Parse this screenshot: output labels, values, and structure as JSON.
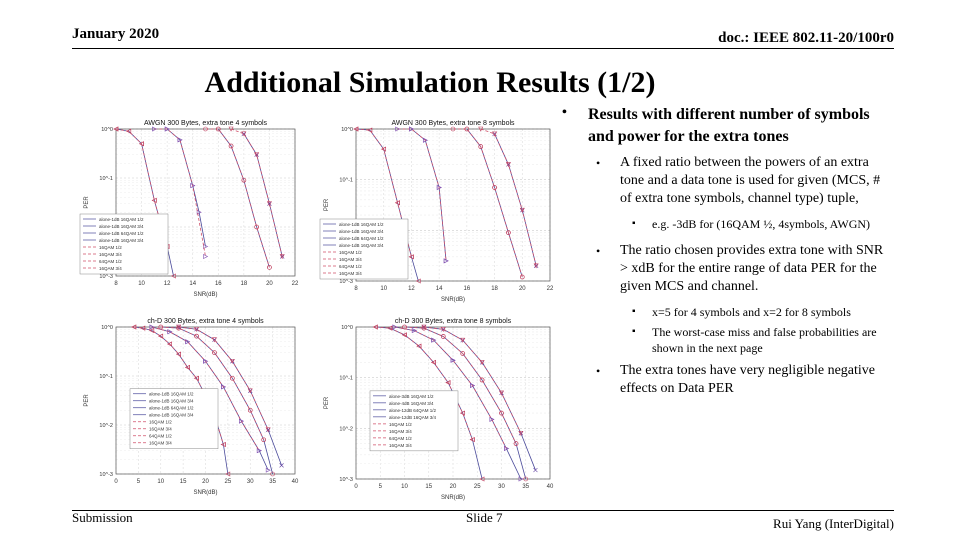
{
  "header": {
    "date": "January 2020",
    "doc": "doc.: IEEE 802.11-20/100r0"
  },
  "title": "Additional Simulation Results (1/2)",
  "bullets": {
    "main": "Results with different number of symbols and power for the extra tones",
    "sub1": "A fixed ratio between the powers of an extra tone and a data tone is used for given (MCS, # of extra tone symbols, channel type) tuple,",
    "sub1_1": "e.g. -3dB for (16QAM ½, 4symbols, AWGN)",
    "sub2": "The ratio chosen provides extra tone with SNR > xdB for the entire range of data PER for the given MCS and channel.",
    "sub2_1": "x=5 for 4 symbols and x=2 for 8 symbols",
    "sub2_2": "The worst-case miss and false probabilities are shown in the next page",
    "sub3": "The extra tones have very negligible negative effects on Data PER"
  },
  "footer": {
    "left": "Submission",
    "center": "Slide 7",
    "right": "Rui Yang (InterDigital)"
  },
  "chart_data": [
    {
      "type": "line",
      "title": "AWGN 300 Bytes, extra tone 4 symbols",
      "xlabel": "SNR(dB)",
      "ylabel": "PER",
      "xlim": [
        8,
        22
      ],
      "ylim": [
        0.001,
        1
      ],
      "yscale": "log",
      "xticks": [
        8,
        10,
        12,
        14,
        16,
        18,
        20,
        22
      ],
      "yticks": [
        "10^0",
        "10^-1",
        "10^-2",
        "10^-3"
      ],
      "grid": true,
      "legend": "bottom-left",
      "series": [
        {
          "name": "alone-1dB 16QAM 1/2",
          "x": [
            8,
            9,
            10,
            11,
            12,
            12.5
          ],
          "y": [
            1,
            0.9,
            0.5,
            0.035,
            0.004,
            0.001
          ]
        },
        {
          "name": "alone-1dB 16QAM 3/4",
          "x": [
            12,
            13,
            14,
            14.5,
            15
          ],
          "y": [
            1,
            0.6,
            0.07,
            0.02,
            0.004
          ]
        },
        {
          "name": "alone-1dB 64QAM 1/2",
          "x": [
            16,
            17,
            18,
            19,
            20
          ],
          "y": [
            1,
            0.45,
            0.09,
            0.01,
            0.0015
          ]
        },
        {
          "name": "alone-1dB 16QAM 3/4",
          "x": [
            18,
            19,
            20,
            21
          ],
          "y": [
            0.8,
            0.3,
            0.03,
            0.0025
          ]
        },
        {
          "name": "16QAM 1/2",
          "x": [
            8,
            9,
            10,
            11,
            12
          ],
          "y": [
            1,
            0.9,
            0.5,
            0.035,
            0.004
          ]
        },
        {
          "name": "16QAM 3/4",
          "x": [
            11,
            12,
            13,
            14,
            15
          ],
          "y": [
            1,
            1,
            0.6,
            0.07,
            0.0025
          ]
        },
        {
          "name": "64QAM 1/2",
          "x": [
            15,
            16,
            17,
            18,
            19,
            20
          ],
          "y": [
            1,
            1,
            0.45,
            0.09,
            0.01,
            0.0015
          ]
        },
        {
          "name": "16QAM 3/4",
          "x": [
            17,
            18,
            19,
            20,
            21
          ],
          "y": [
            1,
            0.8,
            0.3,
            0.03,
            0.0025
          ]
        }
      ]
    },
    {
      "type": "line",
      "title": "AWGN 300 Bytes, extra tone 8 symbols",
      "xlabel": "SNR(dB)",
      "ylabel": "PER",
      "xlim": [
        8,
        22
      ],
      "ylim": [
        0.001,
        1
      ],
      "yscale": "log",
      "xticks": [
        8,
        10,
        12,
        14,
        16,
        18,
        20,
        22
      ],
      "yticks": [
        "10^0",
        "10^-1",
        "10^-2",
        "10^-3"
      ],
      "grid": true,
      "legend": "bottom-left",
      "series": [
        {
          "name": "alone-1dB 16QAM 1/2",
          "x": [
            8,
            9,
            10,
            11,
            12,
            12.5
          ],
          "y": [
            1,
            0.95,
            0.4,
            0.035,
            0.003,
            0.001
          ]
        },
        {
          "name": "alone-1dB 16QAM 3/4",
          "x": [
            12,
            13,
            14,
            14.5
          ],
          "y": [
            1,
            0.6,
            0.07,
            0.0025
          ]
        },
        {
          "name": "alone-1dB 64QAM 1/2",
          "x": [
            16,
            17,
            18,
            19,
            20
          ],
          "y": [
            1,
            0.45,
            0.07,
            0.009,
            0.0012
          ]
        },
        {
          "name": "alone-1dB 16QAM 3/4",
          "x": [
            18,
            19,
            20,
            21
          ],
          "y": [
            0.8,
            0.2,
            0.025,
            0.002
          ]
        },
        {
          "name": "16QAM 1/2",
          "x": [
            8,
            9,
            10,
            11,
            12
          ],
          "y": [
            1,
            0.95,
            0.4,
            0.035,
            0.003
          ]
        },
        {
          "name": "16QAM 3/4",
          "x": [
            11,
            12,
            13,
            14,
            14.5
          ],
          "y": [
            1,
            1,
            0.6,
            0.07,
            0.0025
          ]
        },
        {
          "name": "64QAM 1/2",
          "x": [
            15,
            16,
            17,
            18,
            19,
            20
          ],
          "y": [
            1,
            1,
            0.45,
            0.07,
            0.009,
            0.0012
          ]
        },
        {
          "name": "16QAM 3/4",
          "x": [
            17,
            18,
            19,
            20,
            21
          ],
          "y": [
            1,
            0.8,
            0.2,
            0.025,
            0.002
          ]
        }
      ]
    },
    {
      "type": "line",
      "title": "ch-D 300 Bytes, extra tone 4 symbols",
      "xlabel": "SNR(dB)",
      "ylabel": "PER",
      "xlim": [
        0,
        40
      ],
      "ylim": [
        0.001,
        1
      ],
      "yscale": "log",
      "xticks": [
        0,
        5,
        10,
        15,
        20,
        25,
        30,
        35,
        40
      ],
      "yticks": [
        "10^0",
        "10^-1",
        "10^-2",
        "10^-3"
      ],
      "grid": true,
      "legend": "center-left",
      "series": [
        {
          "name": "alone-1dB 16QAM 1/2",
          "x": [
            4,
            6,
            8,
            10,
            12,
            14,
            16,
            18,
            20,
            22,
            24,
            25
          ],
          "y": [
            1,
            0.95,
            0.85,
            0.65,
            0.45,
            0.28,
            0.15,
            0.09,
            0.04,
            0.016,
            0.004,
            0.001
          ]
        },
        {
          "name": "alone-1dB 16QAM 3/4",
          "x": [
            8,
            12,
            16,
            20,
            24,
            28,
            32,
            34
          ],
          "y": [
            1,
            0.8,
            0.5,
            0.2,
            0.06,
            0.012,
            0.003,
            0.0012
          ]
        },
        {
          "name": "alone-1dB 64QAM 1/2",
          "x": [
            10,
            14,
            18,
            22,
            26,
            30,
            33,
            35
          ],
          "y": [
            1,
            0.95,
            0.65,
            0.3,
            0.09,
            0.02,
            0.005,
            0.001
          ]
        },
        {
          "name": "alone-1dB 16QAM 3/4",
          "x": [
            14,
            18,
            22,
            26,
            30,
            34,
            37
          ],
          "y": [
            1,
            0.9,
            0.55,
            0.2,
            0.05,
            0.008,
            0.0015
          ]
        },
        {
          "name": "16QAM 1/2",
          "x": [
            4,
            6,
            8,
            10,
            12,
            14,
            16,
            18,
            20,
            22,
            24
          ],
          "y": [
            1,
            0.95,
            0.85,
            0.65,
            0.45,
            0.28,
            0.15,
            0.09,
            0.04,
            0.016,
            0.004
          ]
        },
        {
          "name": "16QAM 3/4",
          "x": [
            8,
            12,
            16,
            20,
            24,
            28,
            32
          ],
          "y": [
            1,
            0.8,
            0.5,
            0.2,
            0.06,
            0.012,
            0.003
          ]
        },
        {
          "name": "64QAM 1/2",
          "x": [
            10,
            14,
            18,
            22,
            26,
            30,
            33
          ],
          "y": [
            1,
            0.95,
            0.65,
            0.3,
            0.09,
            0.02,
            0.005
          ]
        },
        {
          "name": "16QAM 3/4",
          "x": [
            14,
            18,
            22,
            26,
            30,
            34
          ],
          "y": [
            1,
            0.9,
            0.55,
            0.2,
            0.05,
            0.008
          ]
        }
      ]
    },
    {
      "type": "line",
      "title": "ch-D 300 Bytes, extra tone 8 symbols",
      "xlabel": "SNR(dB)",
      "ylabel": "PER",
      "xlim": [
        0,
        40
      ],
      "ylim": [
        0.001,
        1
      ],
      "yscale": "log",
      "xticks": [
        0,
        5,
        10,
        15,
        20,
        25,
        30,
        35,
        40
      ],
      "yticks": [
        "10^0",
        "10^-1",
        "10^-2",
        "10^-3"
      ],
      "grid": true,
      "legend": "center-left",
      "series": [
        {
          "name": "alone-3dB 16QAM 1/2",
          "x": [
            4,
            7,
            10,
            13,
            16,
            19,
            22,
            24,
            26
          ],
          "y": [
            1,
            0.95,
            0.7,
            0.42,
            0.2,
            0.08,
            0.02,
            0.006,
            0.001
          ]
        },
        {
          "name": "alone-4dB 16QAM 3/4",
          "x": [
            8,
            12,
            16,
            20,
            24,
            28,
            31,
            34
          ],
          "y": [
            1,
            0.85,
            0.55,
            0.22,
            0.07,
            0.015,
            0.004,
            0.001
          ]
        },
        {
          "name": "alone-12dB 64QAM 1/2",
          "x": [
            10,
            14,
            18,
            22,
            26,
            30,
            33,
            35
          ],
          "y": [
            1,
            0.95,
            0.65,
            0.3,
            0.09,
            0.02,
            0.005,
            0.001
          ]
        },
        {
          "name": "alone-12dB 16QAM 3/4",
          "x": [
            14,
            18,
            22,
            26,
            30,
            34,
            37
          ],
          "y": [
            1,
            0.9,
            0.55,
            0.2,
            0.05,
            0.008,
            0.0015
          ]
        },
        {
          "name": "16QAM 1/2",
          "x": [
            4,
            7,
            10,
            13,
            16,
            19,
            22,
            24
          ],
          "y": [
            1,
            0.95,
            0.7,
            0.42,
            0.2,
            0.08,
            0.02,
            0.006
          ]
        },
        {
          "name": "16QAM 3/4",
          "x": [
            8,
            12,
            16,
            20,
            24,
            28,
            31
          ],
          "y": [
            1,
            0.85,
            0.55,
            0.22,
            0.07,
            0.015,
            0.004
          ]
        },
        {
          "name": "64QAM 1/2",
          "x": [
            10,
            14,
            18,
            22,
            26,
            30,
            33
          ],
          "y": [
            1,
            0.95,
            0.65,
            0.3,
            0.09,
            0.02,
            0.005
          ]
        },
        {
          "name": "16QAM 3/4",
          "x": [
            14,
            18,
            22,
            26,
            30,
            34
          ],
          "y": [
            1,
            0.9,
            0.55,
            0.2,
            0.05,
            0.008
          ]
        }
      ]
    }
  ]
}
